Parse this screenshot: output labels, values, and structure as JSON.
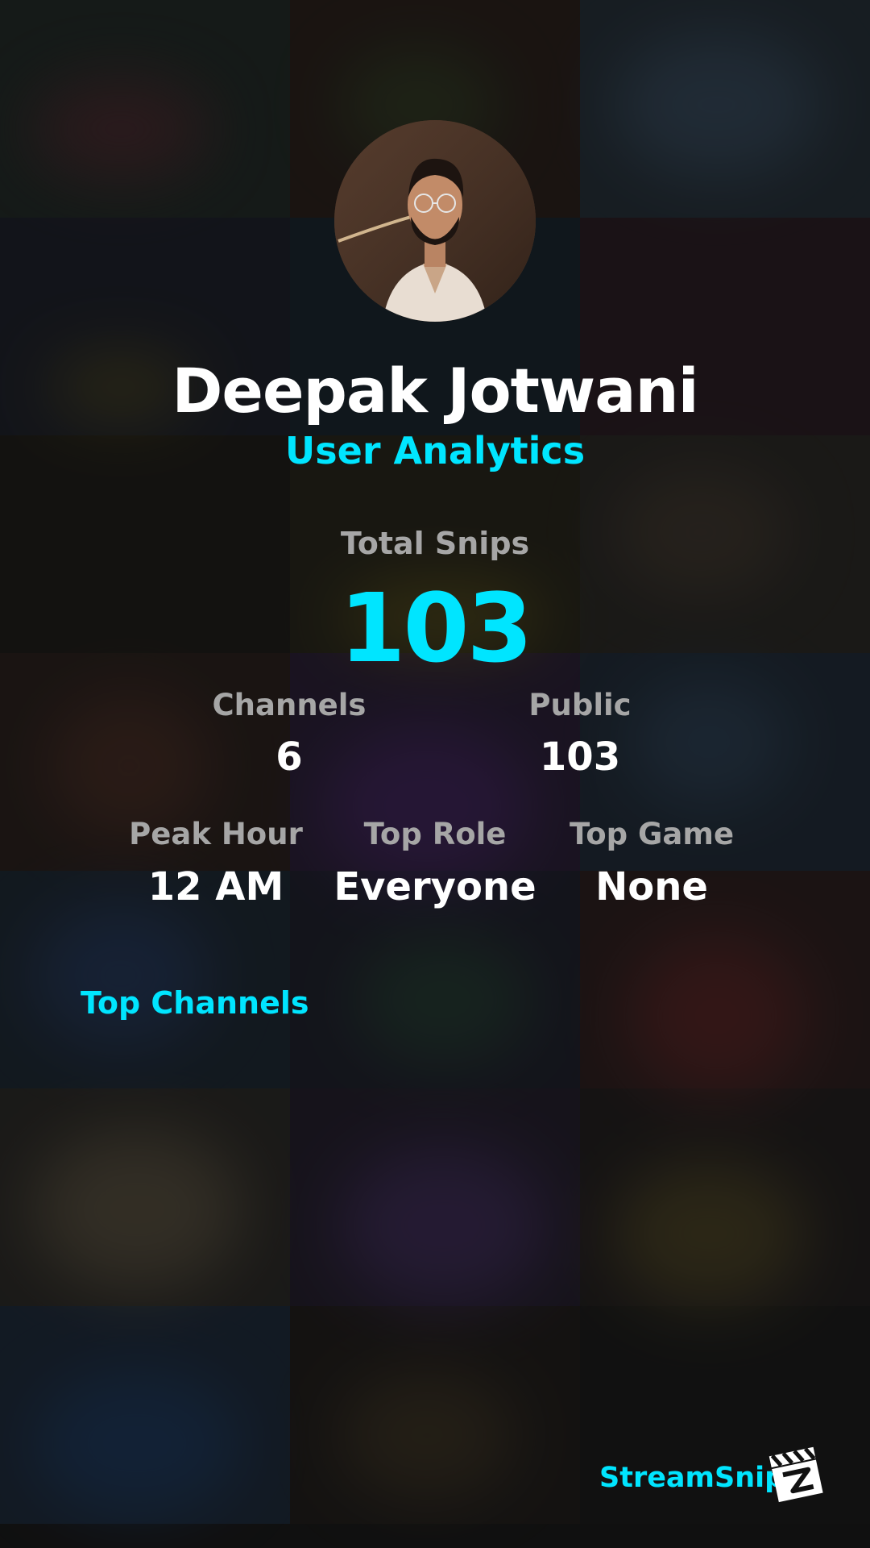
{
  "profile": {
    "name": "Deepak Jotwani",
    "subtitle": "User Analytics"
  },
  "total": {
    "label": "Total Snips",
    "value": "103"
  },
  "stats_row1": [
    {
      "label": "Channels",
      "value": "6"
    },
    {
      "label": "Public",
      "value": "103"
    }
  ],
  "stats_row2": [
    {
      "label": "Peak Hour",
      "value": "12 AM"
    },
    {
      "label": "Top Role",
      "value": "Everyone"
    },
    {
      "label": "Top Game",
      "value": "None"
    }
  ],
  "top_channels": {
    "heading": "Top Channels"
  },
  "brand": {
    "name": "StreamSnip",
    "logo_icon": "clapperboard-icon"
  },
  "colors": {
    "accent": "#00e5ff",
    "label": "#a6a6a6",
    "value": "#ffffff"
  }
}
